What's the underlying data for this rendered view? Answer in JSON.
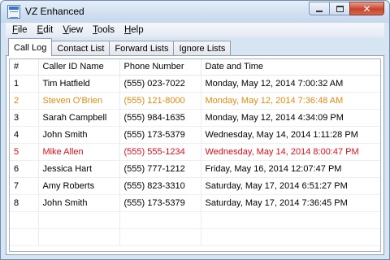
{
  "window": {
    "title": "VZ Enhanced"
  },
  "menu": [
    {
      "first": "F",
      "rest": "ile"
    },
    {
      "first": "E",
      "rest": "dit"
    },
    {
      "first": "V",
      "rest": "iew"
    },
    {
      "first": "T",
      "rest": "ools"
    },
    {
      "first": "H",
      "rest": "elp"
    }
  ],
  "tabs": [
    "Call Log",
    "Contact List",
    "Forward Lists",
    "Ignore Lists"
  ],
  "active_tab": 0,
  "table": {
    "columns": [
      "#",
      "Caller ID Name",
      "Phone Number",
      "Date and Time"
    ],
    "rows": [
      {
        "num": "1",
        "name": "Tim Hatfield",
        "phone": "(555) 023-7022",
        "date": "Monday, May 12, 2014 7:00:32 AM",
        "status": "normal"
      },
      {
        "num": "2",
        "name": "Steven O'Brien",
        "phone": "(555) 121-8000",
        "date": "Monday, May 12, 2014 7:36:48 AM",
        "status": "orange"
      },
      {
        "num": "3",
        "name": "Sarah Campbell",
        "phone": "(555) 984-1635",
        "date": "Monday, May 12, 2014 4:34:09 PM",
        "status": "normal"
      },
      {
        "num": "4",
        "name": "John Smith",
        "phone": "(555) 173-5379",
        "date": "Wednesday, May 14, 2014 1:11:28 PM",
        "status": "normal"
      },
      {
        "num": "5",
        "name": "Mike Allen",
        "phone": "(555) 555-1234",
        "date": "Wednesday, May 14, 2014 8:00:47 PM",
        "status": "red"
      },
      {
        "num": "6",
        "name": "Jessica Hart",
        "phone": "(555) 777-1212",
        "date": "Friday, May 16, 2014 12:07:47 PM",
        "status": "normal"
      },
      {
        "num": "7",
        "name": "Amy Roberts",
        "phone": "(555) 823-3310",
        "date": "Saturday, May 17, 2014 6:51:27 PM",
        "status": "normal"
      },
      {
        "num": "8",
        "name": "John Smith",
        "phone": "(555) 173-5379",
        "date": "Saturday, May 17, 2014 7:36:45 PM",
        "status": "normal"
      }
    ]
  },
  "colors": {
    "orange_row": "#e58a10",
    "red_row": "#e0101c"
  },
  "icons": {
    "app": "app-window-icon",
    "minimize": "minimize-icon",
    "maximize": "maximize-icon",
    "close": "close-icon"
  }
}
